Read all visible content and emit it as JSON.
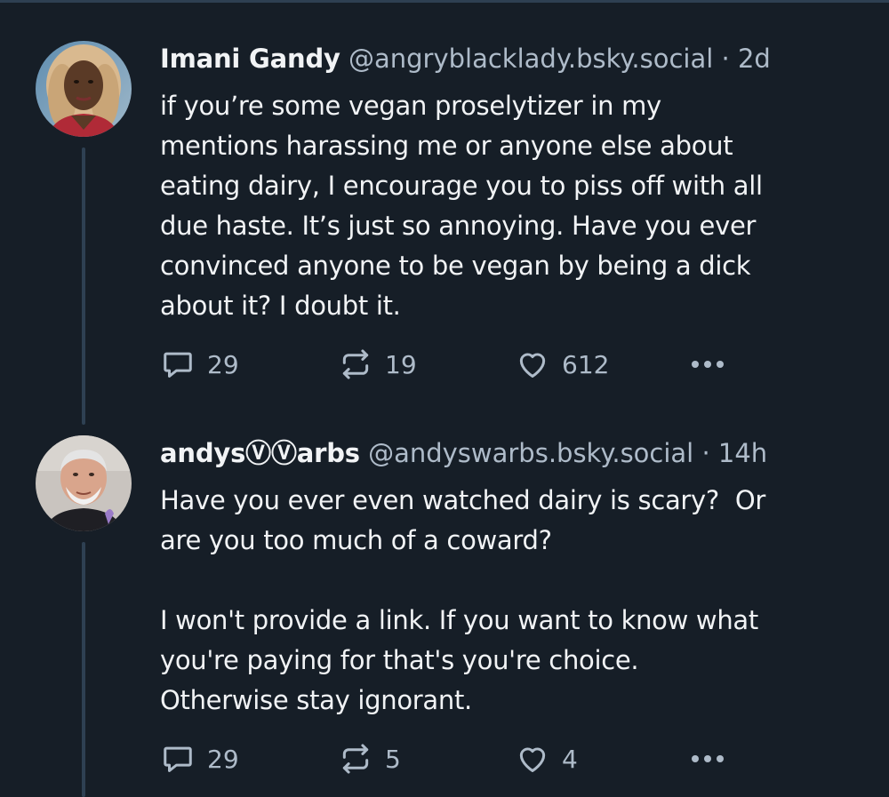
{
  "posts": [
    {
      "display_name": "Imani Gandy",
      "handle": "@angryblacklady.bsky.social",
      "separator": "·",
      "time": "2d",
      "text": "if you’re some vegan proselytizer in my\nmentions harassing me or anyone else about\neating dairy, I encourage you to piss off with all\ndue haste. It’s just so annoying. Have you ever\nconvinced anyone to be vegan by being a dick\nabout it? I doubt it.",
      "replies": "29",
      "reposts": "19",
      "likes": "612",
      "avatar_icon": "user-photo"
    },
    {
      "display_name": "andysⓋⓋarbs",
      "handle": "@andyswarbs.bsky.social",
      "separator": "·",
      "time": "14h",
      "text": "Have you ever even watched dairy is scary?  Or\nare you too much of a coward?\n\nI won't provide a link. If you want to know what\nyou're paying for that's you're choice.\nOtherwise stay ignorant.",
      "replies": "29",
      "reposts": "5",
      "likes": "4",
      "avatar_icon": "user-photo"
    }
  ],
  "icons": {
    "reply": "reply-icon",
    "repost": "repost-icon",
    "like": "heart-icon",
    "more": "more-options-icon"
  },
  "colors": {
    "background": "#161e27",
    "thread_line": "#2e4052",
    "primary_text": "#f1f3f5",
    "secondary_text": "#aebbc9"
  }
}
